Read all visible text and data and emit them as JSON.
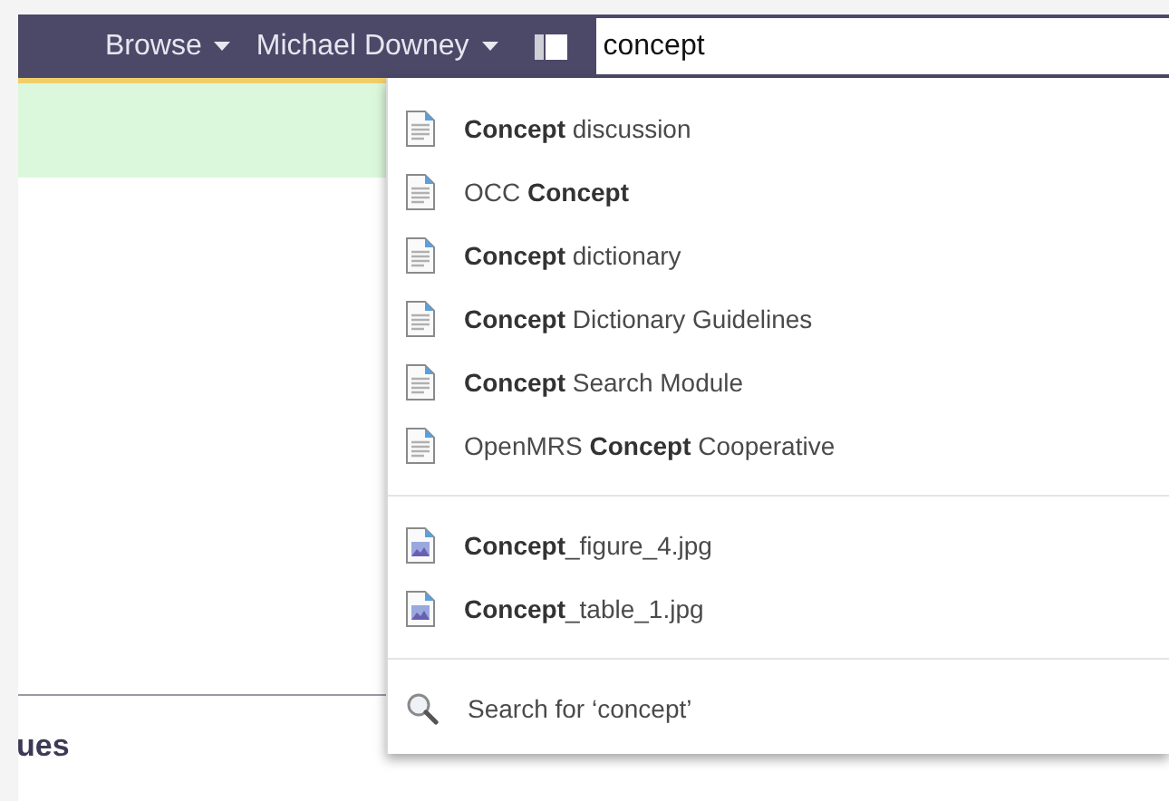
{
  "header": {
    "nav": [
      {
        "label": "Browse",
        "dropdown": true
      },
      {
        "label": "Michael Downey",
        "dropdown": true
      }
    ],
    "search": {
      "value": "concept"
    }
  },
  "search_results": {
    "groups": [
      {
        "items": [
          {
            "kind": "page",
            "label": "**Concept** discussion"
          },
          {
            "kind": "page",
            "label": "OCC **Concept**"
          },
          {
            "kind": "page",
            "label": "**Concept** dictionary"
          },
          {
            "kind": "page",
            "label": "**Concept** Dictionary Guidelines"
          },
          {
            "kind": "page",
            "label": "**Concept** Search Module"
          },
          {
            "kind": "page",
            "label": "OpenMRS **Concept** Cooperative"
          }
        ]
      },
      {
        "items": [
          {
            "kind": "image",
            "label": "**Concept**_figure_4.jpg"
          },
          {
            "kind": "image",
            "label": "**Concept**_table_1.jpg"
          }
        ]
      },
      {
        "items": [
          {
            "kind": "search",
            "label": "Search for ‘concept’"
          }
        ]
      }
    ]
  },
  "content": {
    "heading": "ues"
  }
}
